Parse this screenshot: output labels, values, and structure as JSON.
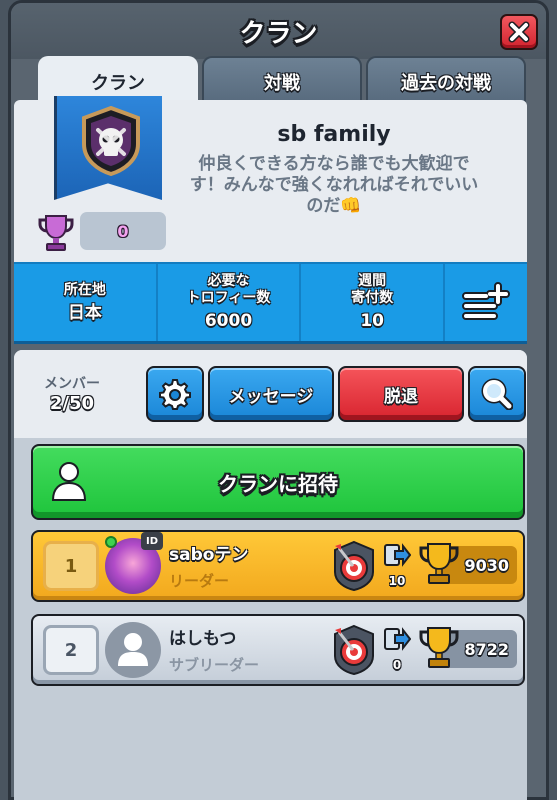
{
  "window": {
    "title": "クラン"
  },
  "tabs": [
    {
      "label": "クラン",
      "active": true
    },
    {
      "label": "対戦",
      "active": false
    },
    {
      "label": "過去の対戦",
      "active": false
    }
  ],
  "clan": {
    "name": "sb family",
    "description": "仲良くできる方なら誰でも大歓迎です！みんなで強くなれればそれでいいのだ👊",
    "trophies": "0",
    "emblem_icon": "skull-shield-icon"
  },
  "stats": [
    {
      "label": "所在地",
      "value": "日本"
    },
    {
      "label": "必要な\nトロフィー数",
      "value": "6000"
    },
    {
      "label": "週間\n寄付数",
      "value": "10"
    }
  ],
  "members_section": {
    "label": "メンバー",
    "count": "2/50",
    "message_button": "メッセージ",
    "leave_button": "脱退",
    "invite_button": "クランに招待"
  },
  "members": [
    {
      "rank": "1",
      "name": "saboテン",
      "role": "リーダー",
      "donations": "10",
      "trophies": "9030",
      "online": true,
      "id_badge": "ID"
    },
    {
      "rank": "2",
      "name": "はしもつ",
      "role": "サブリーダー",
      "donations": "0",
      "trophies": "8722",
      "online": false
    }
  ],
  "colors": {
    "accent_blue": "#1a9be6",
    "invite_green": "#1ec43b",
    "leave_red": "#d8242f",
    "leader_gold": "#f2a81d"
  }
}
